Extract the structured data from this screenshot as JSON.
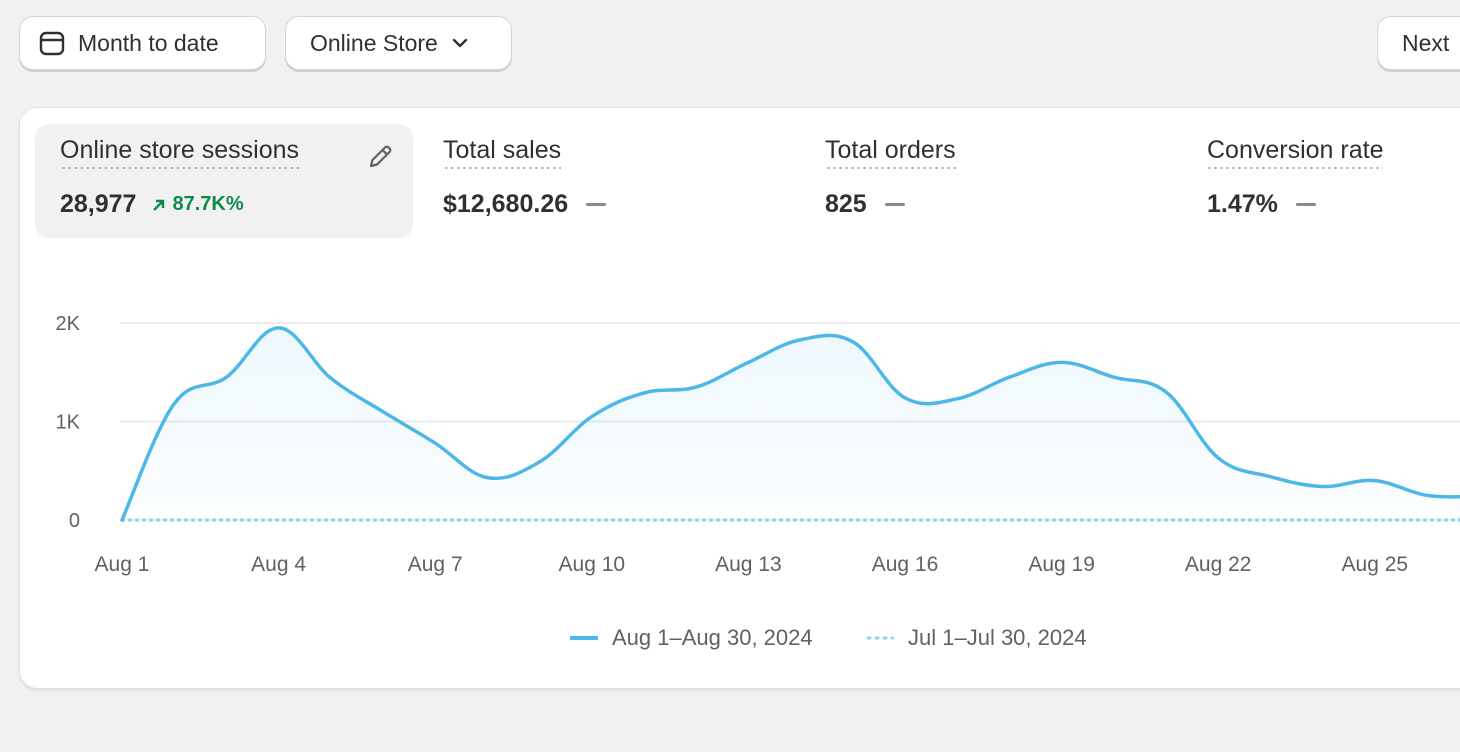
{
  "toolbar": {
    "date_range_label": "Month to date",
    "channel_label": "Online Store",
    "next_label": "Next"
  },
  "metrics": [
    {
      "label": "Online store sessions",
      "value": "28,977",
      "change": "87.7K%",
      "change_direction": "up",
      "active": true
    },
    {
      "label": "Total sales",
      "value": "$12,680.26",
      "change": null
    },
    {
      "label": "Total orders",
      "value": "825",
      "change": null
    },
    {
      "label": "Conversion rate",
      "value": "1.47%",
      "change": null
    }
  ],
  "icons": {
    "date": "calendar-icon",
    "channel": "chevron-down-icon",
    "edit": "pencil-icon",
    "trend": "arrow-up-right-icon"
  },
  "colors": {
    "current_series": "#4db8e6",
    "previous_series": "#8fd3f0",
    "positive_change": "#0c8a4a"
  },
  "chart_data": {
    "type": "area",
    "y_ticks": [
      "2K",
      "1K",
      "0"
    ],
    "ylim": [
      0,
      2000
    ],
    "x_ticks": [
      "Aug 1",
      "Aug 4",
      "Aug 7",
      "Aug 10",
      "Aug 13",
      "Aug 16",
      "Aug 19",
      "Aug 22",
      "Aug 25"
    ],
    "x": [
      "Aug 1",
      "Aug 2",
      "Aug 3",
      "Aug 4",
      "Aug 5",
      "Aug 6",
      "Aug 7",
      "Aug 8",
      "Aug 9",
      "Aug 10",
      "Aug 11",
      "Aug 12",
      "Aug 13",
      "Aug 14",
      "Aug 15",
      "Aug 16",
      "Aug 17",
      "Aug 18",
      "Aug 19",
      "Aug 20",
      "Aug 21",
      "Aug 22",
      "Aug 23",
      "Aug 24",
      "Aug 25",
      "Aug 26",
      "Aug 27"
    ],
    "grid": true,
    "series": [
      {
        "name": "Aug 1–Aug 30, 2024",
        "style": "solid",
        "values": [
          0,
          1180,
          1450,
          1950,
          1440,
          1100,
          780,
          430,
          590,
          1050,
          1290,
          1350,
          1600,
          1830,
          1810,
          1240,
          1230,
          1450,
          1600,
          1450,
          1300,
          630,
          440,
          340,
          400,
          250,
          240
        ]
      },
      {
        "name": "Jul 1–Jul 30, 2024",
        "style": "dotted",
        "values": [
          0,
          0,
          0,
          0,
          0,
          0,
          0,
          0,
          0,
          0,
          0,
          0,
          0,
          0,
          0,
          0,
          0,
          0,
          0,
          0,
          0,
          0,
          0,
          0,
          0,
          0,
          0
        ]
      }
    ]
  }
}
